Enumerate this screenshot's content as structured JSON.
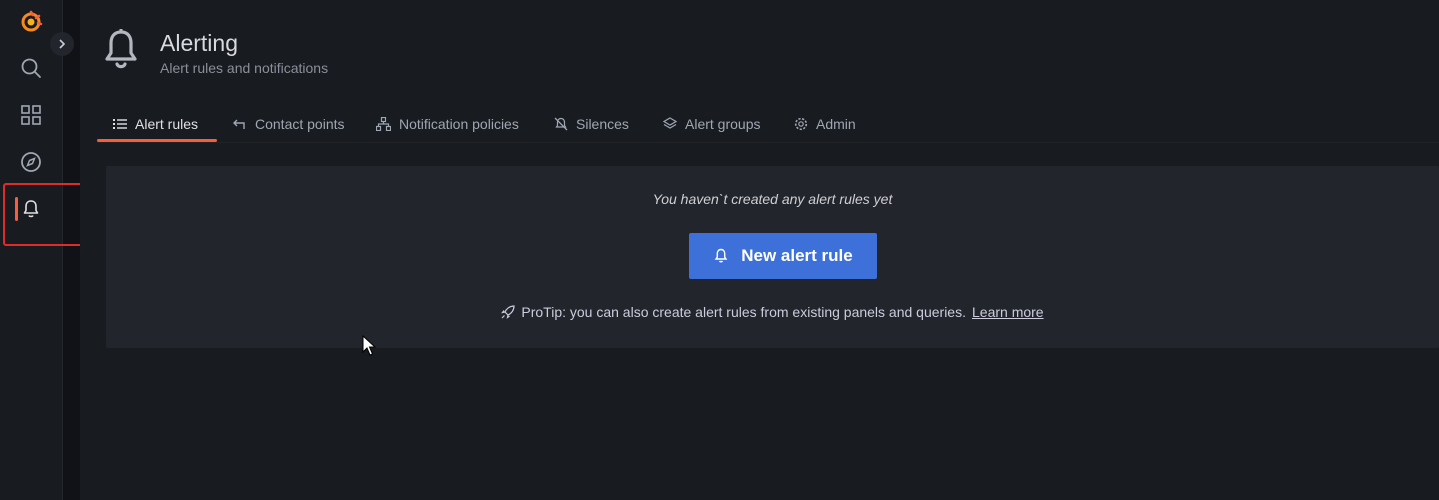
{
  "sidebar": {
    "items": [
      {
        "name": "grafana-logo"
      },
      {
        "name": "search"
      },
      {
        "name": "dashboards"
      },
      {
        "name": "explore"
      },
      {
        "name": "alerting"
      }
    ],
    "active": "alerting"
  },
  "header": {
    "title": "Alerting",
    "subtitle": "Alert rules and notifications"
  },
  "tabs": [
    {
      "label": "Alert rules",
      "icon": "list-icon",
      "active": true
    },
    {
      "label": "Contact points",
      "icon": "comment-icon"
    },
    {
      "label": "Notification policies",
      "icon": "sitemap-icon"
    },
    {
      "label": "Silences",
      "icon": "bell-slash-icon"
    },
    {
      "label": "Alert groups",
      "icon": "layer-group-icon"
    },
    {
      "label": "Admin",
      "icon": "cog-icon"
    }
  ],
  "empty_state": {
    "message": "You haven`t created any alert rules yet",
    "button_label": "New alert rule",
    "protip": "ProTip: you can also create alert rules from existing panels and queries.",
    "learn_more": "Learn more"
  },
  "colors": {
    "accent": "#f55f3e",
    "primary_button": "#3d71d9",
    "highlight_box": "#e02b2b"
  }
}
